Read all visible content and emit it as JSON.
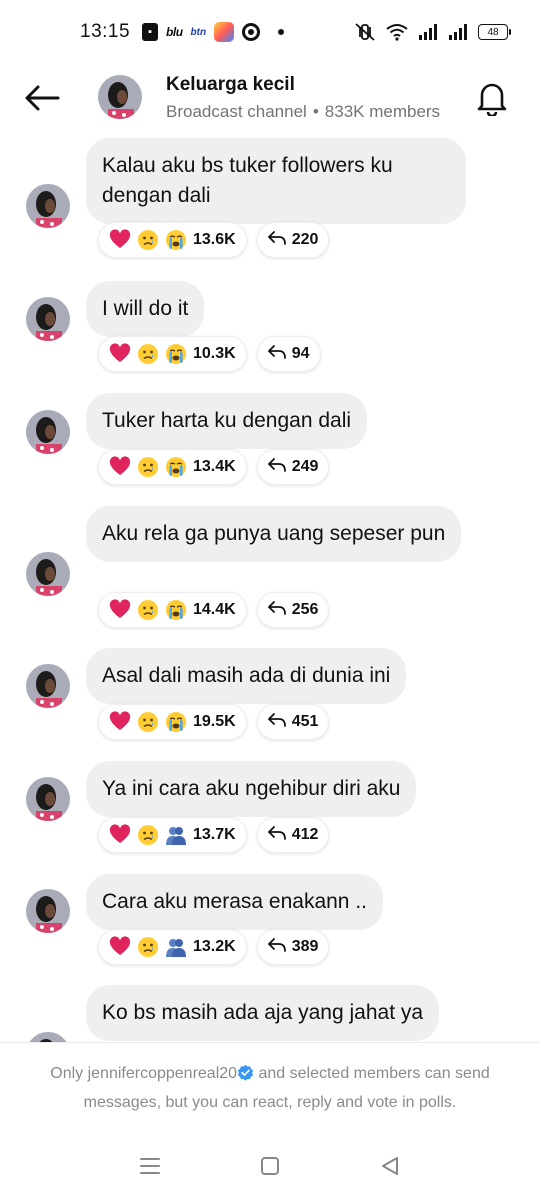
{
  "status_bar": {
    "time": "13:15",
    "apps": [
      "shopping-bag-icon",
      "blu",
      "btn",
      "colorful-app-icon",
      "target-icon"
    ],
    "app_labels": {
      "blu": "blu",
      "btn": "btn"
    },
    "battery": "48"
  },
  "header": {
    "channel_name": "Keluarga kecil",
    "channel_type": "Broadcast channel",
    "members": "833K members"
  },
  "messages": [
    {
      "text": "Kalau aku bs tuker followers ku dengan dali",
      "emojis": [
        "heart",
        "sad",
        "crying"
      ],
      "reaction_count": "13.6K",
      "reply_count": "220"
    },
    {
      "text": "I will do it",
      "emojis": [
        "heart",
        "sad",
        "crying"
      ],
      "reaction_count": "10.3K",
      "reply_count": "94"
    },
    {
      "text": "Tuker harta ku dengan dali",
      "emojis": [
        "heart",
        "sad",
        "crying"
      ],
      "reaction_count": "13.4K",
      "reply_count": "249"
    },
    {
      "text": "Aku rela ga punya uang sepeser pun",
      "emojis": [
        "heart",
        "sad",
        "crying"
      ],
      "reaction_count": "14.4K",
      "reply_count": "256"
    },
    {
      "text": "Asal dali masih ada di dunia ini",
      "emojis": [
        "heart",
        "sad",
        "crying"
      ],
      "reaction_count": "19.5K",
      "reply_count": "451"
    },
    {
      "text": "Ya ini cara aku ngehibur diri aku",
      "emojis": [
        "heart",
        "sad",
        "people-hugging"
      ],
      "reaction_count": "13.7K",
      "reply_count": "412"
    },
    {
      "text": "Cara aku merasa enakann ..",
      "emojis": [
        "heart",
        "sad",
        "people-hugging"
      ],
      "reaction_count": "13.2K",
      "reply_count": "389"
    },
    {
      "text": "Ko bs masih ada aja yang jahat ya",
      "emojis": [],
      "reaction_count": "",
      "reply_count": ""
    }
  ],
  "footer": {
    "prefix": "Only ",
    "username": "jennifercoppenreal20",
    "suffix": " and selected members can send messages, but you can react, reply and vote in polls."
  },
  "colors": {
    "bubble": "#efefef",
    "muted_text": "#737373",
    "verified": "#3897f0",
    "heart": "#e0245e"
  }
}
